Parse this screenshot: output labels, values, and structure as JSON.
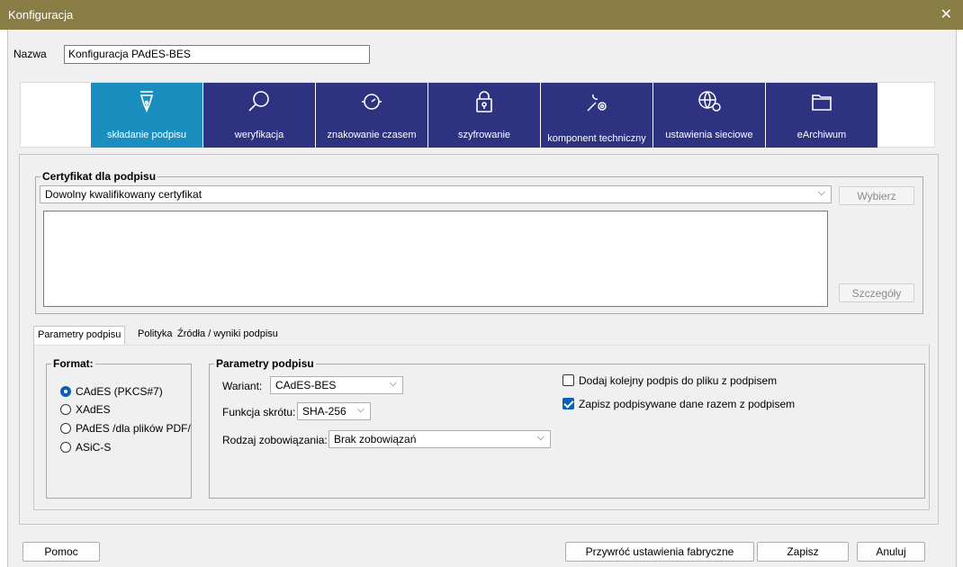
{
  "window": {
    "title": "Konfiguracja",
    "close_glyph": "✕"
  },
  "name_field": {
    "label": "Nazwa",
    "value": "Konfiguracja PAdES-BES"
  },
  "tiles": [
    {
      "label": "składanie podpisu",
      "icon": "pen-nib-icon"
    },
    {
      "label": "weryfikacja",
      "icon": "magnifier-icon"
    },
    {
      "label": "znakowanie czasem",
      "icon": "watch-icon"
    },
    {
      "label": "szyfrowanie",
      "icon": "lock-icon"
    },
    {
      "label": "komponent techniczny",
      "icon": "wrench-gear-icon"
    },
    {
      "label": "ustawienia sieciowe",
      "icon": "globe-gear-icon"
    },
    {
      "label": "eArchiwum",
      "icon": "folder-icon"
    }
  ],
  "certificate": {
    "group_title": "Certyfikat dla podpisu",
    "selected": "Dowolny kwalifikowany certyfikat",
    "choose_button": "Wybierz",
    "details_button": "Szczegóły"
  },
  "tabs": [
    {
      "label": "Parametry podpisu",
      "active": true
    },
    {
      "label": "Polityka",
      "active": false
    },
    {
      "label": "Źródła / wyniki podpisu",
      "active": false
    }
  ],
  "format": {
    "title": "Format:",
    "options": [
      {
        "label": "CAdES (PKCS#7)",
        "selected": true
      },
      {
        "label": "XAdES",
        "selected": false
      },
      {
        "label": "PAdES /dla plików PDF/",
        "selected": false
      },
      {
        "label": "ASiC-S",
        "selected": false
      }
    ]
  },
  "params": {
    "title": "Parametry podpisu",
    "variant_label": "Wariant:",
    "variant_value": "CAdES-BES",
    "hash_label": "Funkcja skrótu:",
    "hash_value": "SHA-256",
    "commitment_label": "Rodzaj zobowiązania:",
    "commitment_value": "Brak zobowiązań",
    "checkboxes": [
      {
        "label": "Dodaj kolejny podpis do pliku z podpisem",
        "checked": false
      },
      {
        "label": "Zapisz podpisywane dane razem z podpisem",
        "checked": true
      }
    ]
  },
  "footer": {
    "help": "Pomoc",
    "restore": "Przywróć ustawienia fabryczne",
    "save": "Zapisz",
    "cancel": "Anuluj"
  },
  "colors": {
    "tile": "#2d3380",
    "tile_active": "#1b8ec0",
    "titlebar": "#8a7c45",
    "accent": "#0b5fb5"
  }
}
